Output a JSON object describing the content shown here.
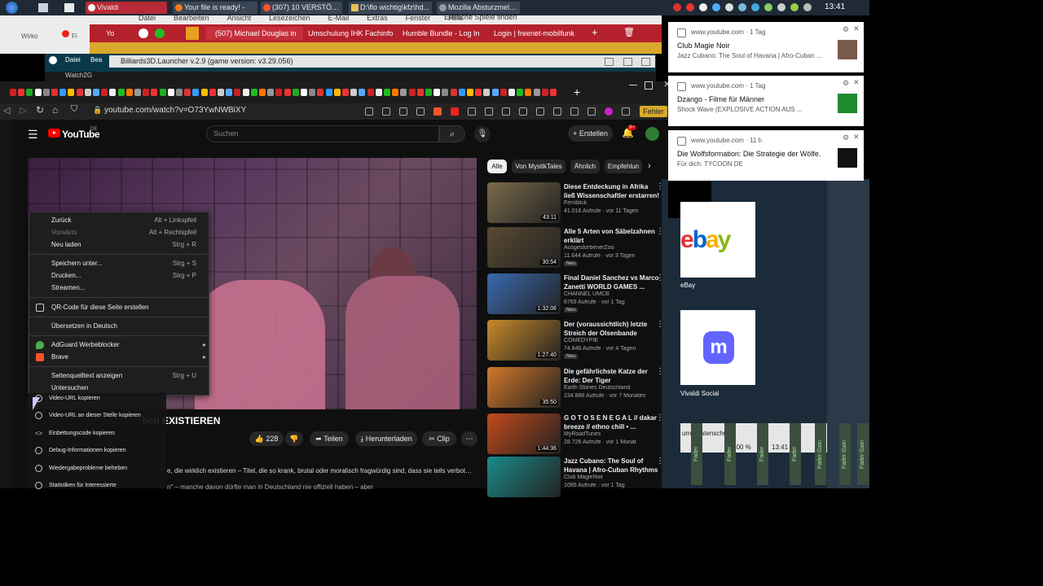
{
  "taskbar": {
    "items": [
      "Vivaldi",
      "Your file is ready! -",
      "(307) 10 VERSTÖREN...",
      "D:\\flo wichtig\\kfz\\hd...",
      "Mozilla Absturzmelder"
    ],
    "clock": "13:41"
  },
  "bg": {
    "menu": [
      "Datei",
      "Bearbeiten",
      "Ansicht",
      "Lesezeichen",
      "E-Mail",
      "Extras",
      "Fenster",
      "Hilfe"
    ],
    "menu_right": "Einfache Spiele finden",
    "vivaldi_tabs": [
      "(507) Michael Douglas in",
      "Umschulung IHK Fachinfo",
      "Humble Bundle - Log In",
      "Login | freenet-mobilfunk"
    ],
    "bookmarks": [
      "Wirko",
      "Fi",
      "Yo"
    ],
    "launcher_title": "Billiards3D.Launcher v.2.9 (game version: v3.29.056)",
    "win2_menu": [
      "Datei",
      "Bea"
    ],
    "win3_label": "Watch2G"
  },
  "browser": {
    "url": "youtube.com/watch?v=O73YwNWBiXY",
    "error_label": "Fehler"
  },
  "youtube": {
    "logo": "YouTube",
    "country": "DE",
    "search_placeholder": "Suchen",
    "create_label": "Erstellen",
    "bell_badge": "9+",
    "title_partial": "lich EXISTIEREN",
    "actions": {
      "likes": "228",
      "share": "Teilen",
      "download": "Herunterladen",
      "clip": "Clip"
    },
    "description": "e, die wirklich existieren – Titel, die so krank, brutal oder moralisch fragwürdig sind, dass sie teils verboten,",
    "description2": "n\" – manche davon dürfte man in Deutschland nie offiziell haben – aber",
    "chips": [
      "Alle",
      "Von MystikTales",
      "Ähnlich",
      "Empfehlun"
    ],
    "recommendations": [
      {
        "title": "Diese Entdeckung in Afrika ließ Wissenschaftler erstarren!",
        "channel": "Fernblick",
        "meta": "41.016 Aufrufe · vor 11 Tagen",
        "duration": "43:11",
        "badge": "",
        "color": "#7a6a4a"
      },
      {
        "title": "Alle 5 Arten von Säbelzahnen erklärt",
        "channel": "AusgestorbenerZoo",
        "meta": "11.644 Aufrufe · vor 3 Tagen",
        "duration": "30:54",
        "badge": "Neu",
        "color": "#5a4a32"
      },
      {
        "title": "Final   Daniel Sanchez vs Marco Zanetti WORLD GAMES ...",
        "channel": "CHANNEL UMCB",
        "meta": "6769 Aufrufe · vor 1 Tag",
        "duration": "1:32:06",
        "badge": "Neu",
        "color": "#3a6ab0"
      },
      {
        "title": "Der (voraussichtlich) letzte Streich der Olsenbande (KRIM...",
        "channel": "COMEDYPIE",
        "meta": "74.846 Aufrufe · vor 4 Tagen",
        "duration": "1:27:40",
        "badge": "Neu",
        "color": "#c88a2a"
      },
      {
        "title": "Die gefährlichste Katze der Erde: Der Tiger",
        "channel": "Earth Stories Deutschland",
        "meta": "234.888 Aufrufe · vor 7 Monaten",
        "duration": "35:50",
        "badge": "",
        "color": "#d2782a"
      },
      {
        "title": "G O T O  S E N E G A L // dakar breeze // ethno chill • ...",
        "channel": "MyRoadTunes",
        "meta": "28.726 Aufrufe · vor 1 Monat",
        "duration": "1:44:36",
        "badge": "",
        "color": "#c24a1a"
      },
      {
        "title": "Jazz Cubano: The Soul of Havana | Afro-Cuban Rhythms ...",
        "channel": "Club MagieNoir",
        "meta": "1095 Aufrufe · vor 1 Tag",
        "duration": "",
        "badge": "",
        "color": "#1a8a8a"
      }
    ]
  },
  "context_menu": {
    "items": [
      {
        "label": "Zurück",
        "shortcut": "Alt + Linkspfeil"
      },
      {
        "label": "Vorwärts",
        "shortcut": "Alt + Rechtspfeil"
      },
      {
        "label": "Neu laden",
        "shortcut": "Strg + R"
      },
      {
        "label": "Speichern unter...",
        "shortcut": "Strg + S"
      },
      {
        "label": "Drucken...",
        "shortcut": "Strg + P"
      },
      {
        "label": "Streamen...",
        "shortcut": ""
      },
      {
        "label": "QR-Code für diese Seite erstellen",
        "shortcut": ""
      },
      {
        "label": "Übersetzen in Deutsch",
        "shortcut": ""
      },
      {
        "label": "AdGuard Werbeblocker",
        "shortcut": ""
      },
      {
        "label": "Brave",
        "shortcut": ""
      },
      {
        "label": "Seitenquelltext anzeigen",
        "shortcut": "Strg + U"
      },
      {
        "label": "Untersuchen",
        "shortcut": ""
      }
    ]
  },
  "yt_menu": {
    "items": [
      "Video-URL kopieren",
      "Video-URL an dieser Stelle kopieren",
      "Einbettungscode kopieren",
      "Debug-Informationen kopieren",
      "Wiedergabeprobleme beheben",
      "Statistiken für Interessierte"
    ]
  },
  "notifications": [
    {
      "source": "www.youtube.com · 1 Tag",
      "heading": "Club Magie Noir",
      "body": "Jazz Cubano: The Soul of Havana | Afro-Cuban ..."
    },
    {
      "source": "www.youtube.com · 1 Tag",
      "heading": "Dzango - Filme für Männer",
      "body": "Shock Wave (EXPLOSIVE ACTION AUS ..."
    },
    {
      "source": "www.youtube.com · 11 h",
      "heading": "Die Wolfsformation: Die Strategie der Wölfe.",
      "body": "Für dich: TYCOON DE"
    }
  ],
  "startpage": {
    "ebay_logo": "ebay",
    "ebay_label": "eBay",
    "mastodon_label": "Vivaldi Social",
    "status_datenschutz": "Datenschutz",
    "status_left": "um",
    "status_zoom": "100 %",
    "status_time": "13:41"
  },
  "mixer": {
    "faders": [
      "Fader",
      "Fader",
      "Fader",
      "Fader",
      "Fader Gain",
      "Fader Gain",
      "Fader Gain"
    ]
  }
}
